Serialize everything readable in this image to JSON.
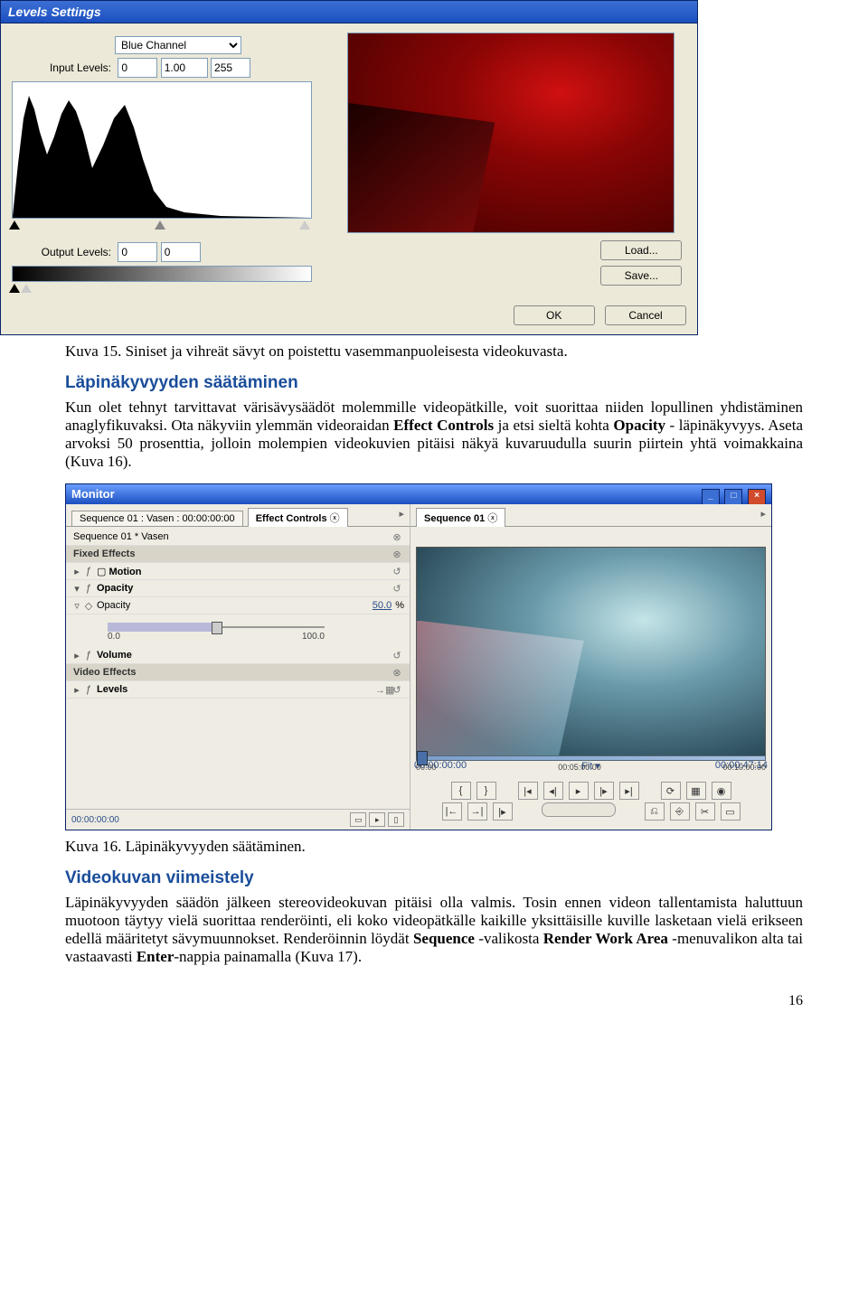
{
  "levels": {
    "title": "Levels Settings",
    "channel_label": "Blue Channel",
    "input_label": "Input Levels:",
    "input_min": "0",
    "input_gamma": "1.00",
    "input_max": "255",
    "output_label": "Output Levels:",
    "output_min": "0",
    "output_max": "0",
    "btn_load": "Load...",
    "btn_save": "Save...",
    "btn_ok": "OK",
    "btn_cancel": "Cancel"
  },
  "caption1": "Kuva 15. Siniset ja vihreät sävyt on poistettu vasemmanpuoleisesta videokuvasta.",
  "heading1": "Läpinäkyvyyden säätäminen",
  "para1_a": "Kun olet tehnyt tarvittavat värisävysäädöt molemmille videopätkille, voit suorittaa niiden lopullinen yhdistäminen anaglyfikuvaksi. Ota näkyviin ylemmän videoraidan ",
  "para1_b": "Effect Controls",
  "para1_c": " ja etsi sieltä kohta ",
  "para1_d": "Opacity",
  "para1_e": " - läpinäkyvyys. Aseta arvoksi 50 prosenttia, jolloin molempien videokuvien pitäisi näkyä kuvaruudulla suurin piirtein yhtä voimakkaina (Kuva 16).",
  "monitor": {
    "title": "Monitor",
    "tab_seq": "Sequence 01 : Vasen : 00:00:00:00",
    "tab_ec": "Effect Controls",
    "subhdr": "Sequence 01 * Vasen",
    "grp_fixed": "Fixed Effects",
    "fx_motion": "Motion",
    "fx_opacity": "Opacity",
    "fx_opacity_row": "Opacity",
    "opacity_val": "50.0",
    "opacity_pct": "%",
    "scale_min": "0.0",
    "scale_max": "100.0",
    "fx_volume": "Volume",
    "grp_video": "Video Effects",
    "fx_levels": "Levels",
    "tl_l": "00:00:00:00",
    "right_tab": "Sequence 01",
    "tc_left": "00:00:00:00",
    "tc_mode": "Fit",
    "tc_right": "00:00:47:14",
    "tm0": "00:00",
    "tm1": "00:05:00:00",
    "tm2": "00:10:00:00"
  },
  "caption2": "Kuva 16. Läpinäkyvyyden säätäminen.",
  "heading2": "Videokuvan viimeistely",
  "para2_a": "Läpinäkyvyyden säädön jälkeen stereovideokuvan pitäisi olla valmis. Tosin ennen videon tallentamista haluttuun muotoon täytyy vielä suorittaa renderöinti, eli koko videopätkälle kaikille yksittäisille kuville lasketaan vielä erikseen edellä määritetyt sävymuunnokset. Renderöinnin löydät ",
  "para2_b": "Sequence ",
  "para2_c": "-valikosta ",
  "para2_d": "Render Work Area ",
  "para2_e": "-menuvalikon alta tai vastaavasti ",
  "para2_f": "Enter",
  "para2_g": "-nappia painamalla (Kuva 17).",
  "pagenum": "16"
}
